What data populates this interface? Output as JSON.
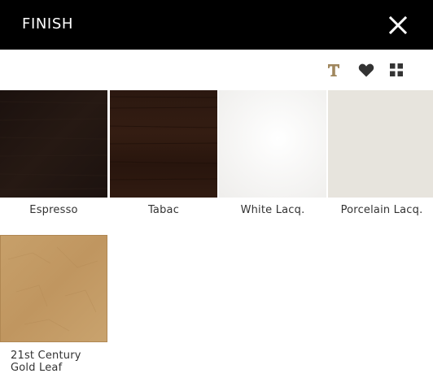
{
  "header": {
    "title": "FINISH",
    "close_icon": "close-icon"
  },
  "toolbar": {
    "icons": [
      "text-icon",
      "heart-icon",
      "grid-icon"
    ],
    "text_icon_color": "#A0875E",
    "icon_color": "#333333"
  },
  "finishes": [
    {
      "name": "Espresso",
      "color": "#201511"
    },
    {
      "name": "Tabac",
      "color": "#2a1710"
    },
    {
      "name": "White Lacq.",
      "color": "#f7f6f5"
    },
    {
      "name": "Porcelain Lacq.",
      "color": "#e6e3dc"
    },
    {
      "name_line1": "21st Century",
      "name_line2": "Gold Leaf",
      "color": "#c49c64"
    }
  ]
}
